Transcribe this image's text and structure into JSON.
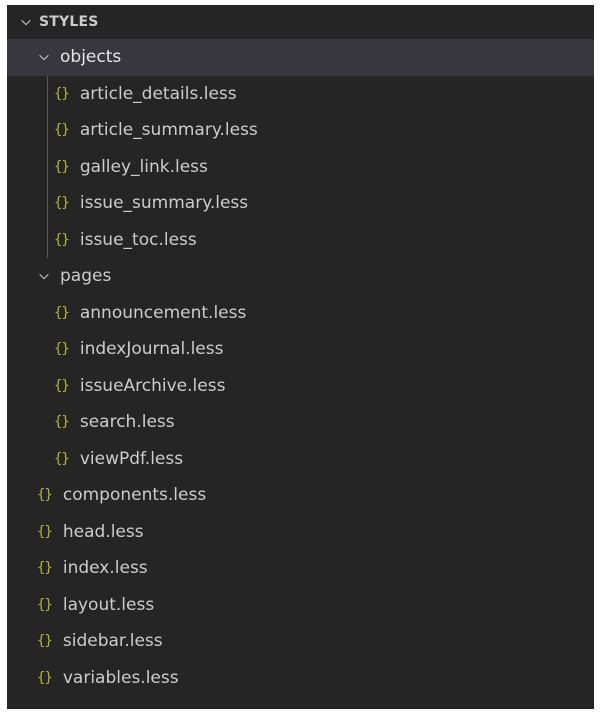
{
  "section": {
    "title": "STYLES"
  },
  "folders": {
    "objects": {
      "label": "objects",
      "files": [
        "article_details.less",
        "article_summary.less",
        "galley_link.less",
        "issue_summary.less",
        "issue_toc.less"
      ]
    },
    "pages": {
      "label": "pages",
      "files": [
        "announcement.less",
        "indexJournal.less",
        "issueArchive.less",
        "search.less",
        "viewPdf.less"
      ]
    }
  },
  "root_files": [
    "components.less",
    "head.less",
    "index.less",
    "layout.less",
    "sidebar.less",
    "variables.less"
  ],
  "icons": {
    "file_icon": "{}",
    "folder_expanded": "chevron-down-icon",
    "file_icon_color": "#cbcb41"
  },
  "colors": {
    "background": "#252526",
    "selected_row": "#37373d",
    "text": "#cccccc"
  }
}
